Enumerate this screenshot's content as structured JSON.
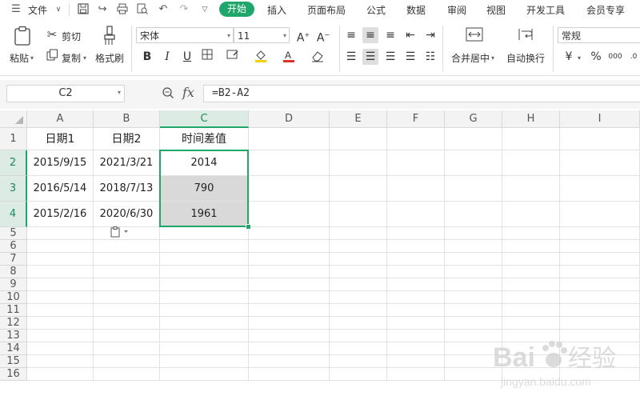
{
  "menubar": {
    "file": "文件",
    "tabs": [
      "开始",
      "插入",
      "页面布局",
      "公式",
      "数据",
      "审阅",
      "视图",
      "开发工具",
      "会员专享"
    ],
    "active_tab": "开始",
    "accent": "#1fa66b"
  },
  "ribbon": {
    "paste": "粘贴",
    "cut": "剪切",
    "copy": "复制",
    "format_painter": "格式刷",
    "font_name": "宋体",
    "font_size": "11",
    "merge_center": "合并居中",
    "wrap_text": "自动换行",
    "number_format": "常规",
    "currency_symbol": "¥",
    "percent_symbol": "%",
    "thousands_symbol": "000"
  },
  "formula_bar": {
    "name_box": "C2",
    "fx": "fx",
    "formula": "=B2-A2"
  },
  "sheet": {
    "columns": [
      "A",
      "B",
      "C",
      "D",
      "E",
      "F",
      "G",
      "H",
      "I"
    ],
    "selected_column": "C",
    "rows": [
      "1",
      "2",
      "3",
      "4",
      "5",
      "6",
      "7",
      "8",
      "9",
      "10",
      "11",
      "12",
      "13",
      "14",
      "15",
      "16"
    ],
    "selected_rows": [
      "2",
      "3",
      "4"
    ],
    "header": [
      "日期1",
      "日期2",
      "时间差值"
    ],
    "data": [
      [
        "2015/9/15",
        "2021/3/21",
        "2014"
      ],
      [
        "2016/5/14",
        "2018/7/13",
        "790"
      ],
      [
        "2015/2/16",
        "2020/6/30",
        "1961"
      ]
    ]
  },
  "watermark": {
    "brand": "Baidu",
    "suffix": "经验",
    "url": "jingyan.baidu.com"
  }
}
